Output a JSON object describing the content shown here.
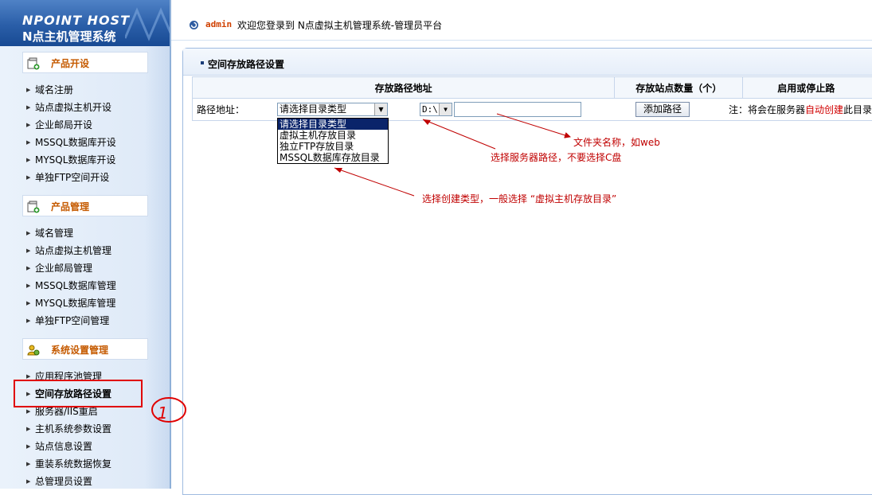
{
  "logo": {
    "brand": "NPOINT HOST",
    "subtitle": "N点主机管理系统"
  },
  "header": {
    "username": "admin",
    "welcome": "欢迎您登录到 N点虚拟主机管理系统-管理员平台"
  },
  "sidebar": {
    "sections": [
      {
        "title": "产品开设",
        "items": [
          "域名注册",
          "站点虚拟主机开设",
          "企业邮局开设",
          "MSSQL数据库开设",
          "MYSQL数据库开设",
          "单独FTP空间开设"
        ]
      },
      {
        "title": "产品管理",
        "items": [
          "域名管理",
          "站点虚拟主机管理",
          "企业邮局管理",
          "MSSQL数据库管理",
          "MYSQL数据库管理",
          "单独FTP空间管理"
        ]
      },
      {
        "title": "系统设置管理",
        "items": [
          "应用程序池管理",
          "空间存放路径设置",
          "服务器/IIS重启",
          "主机系统参数设置",
          "站点信息设置",
          "重装系统数据恢复",
          "总管理员设置"
        ]
      }
    ]
  },
  "main": {
    "panel_title": "空间存放路径设置",
    "table": {
      "headers": [
        "存放路径地址",
        "存放站点数量（个）",
        "启用或停止路"
      ],
      "row_label": "路径地址："
    },
    "type_select": {
      "value": "请选择目录类型",
      "options": [
        "请选择目录类型",
        "虚拟主机存放目录",
        "独立FTP存放目录",
        "MSSQL数据库存放目录"
      ]
    },
    "drive_select": {
      "value": "D:\\"
    },
    "folder_input": {
      "value": ""
    },
    "add_button": "添加路径",
    "note": {
      "prefix": "注：将会在服务器",
      "highlight": "自动创建",
      "suffix": "此目录"
    }
  },
  "annotations": {
    "folder": "文件夹名称，如web",
    "drive": "选择服务器路径，不要选择C盘",
    "type": "选择创建类型，一般选择 “虚拟主机存放目录”",
    "circle_mark": "1"
  },
  "colors": {
    "annotation": "#c00000",
    "section_title": "#c55a00",
    "logo_bg": "#2a5ea8"
  },
  "icons": {
    "section": "box-add-icon",
    "settings": "gear-users-icon",
    "header": "spiral-icon",
    "menu_bullet": "triangle-right-icon"
  }
}
